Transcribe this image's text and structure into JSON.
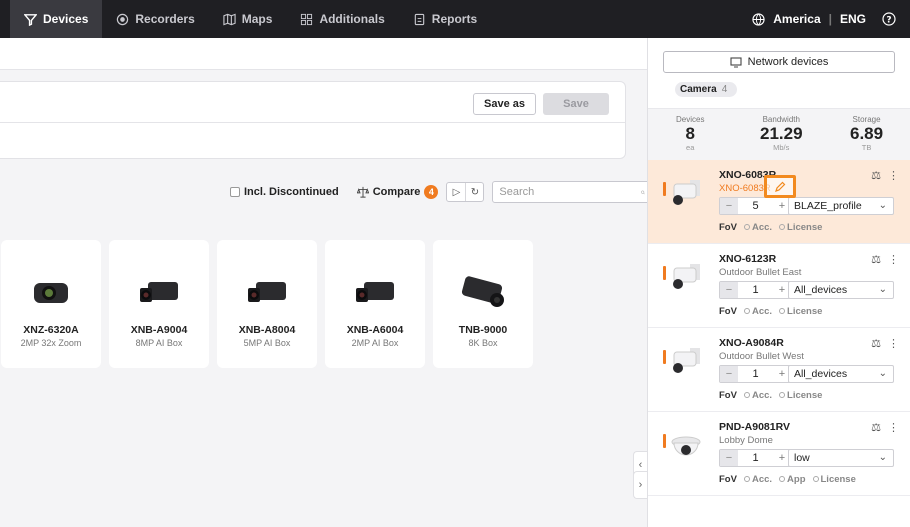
{
  "nav": {
    "tabs": [
      {
        "label": "Devices",
        "icon": "devices-icon"
      },
      {
        "label": "Recorders",
        "icon": "recorder-icon"
      },
      {
        "label": "Maps",
        "icon": "map-icon"
      },
      {
        "label": "Additionals",
        "icon": "grid-icon"
      },
      {
        "label": "Reports",
        "icon": "report-icon"
      }
    ],
    "region": "America",
    "language": "ENG"
  },
  "save": {
    "save_as_label": "Save as",
    "save_label": "Save"
  },
  "toolbar": {
    "discontinued_label": "Incl. Discontinued",
    "compare_label": "Compare",
    "compare_count": "4",
    "search_placeholder": "Search"
  },
  "products": [
    {
      "name": "XNZ-6320A",
      "desc": "2MP 32x Zoom"
    },
    {
      "name": "XNB-A9004",
      "desc": "8MP AI Box"
    },
    {
      "name": "XNB-A8004",
      "desc": "5MP AI Box"
    },
    {
      "name": "XNB-A6004",
      "desc": "2MP AI Box"
    },
    {
      "name": "TNB-9000",
      "desc": "8K Box"
    }
  ],
  "panel": {
    "network_button_label": "Network devices",
    "camera_tab": {
      "label": "Camera",
      "count": "4"
    },
    "stats": {
      "devices": {
        "label": "Devices",
        "value": "8",
        "unit": "ea"
      },
      "bandwidth": {
        "label": "Bandwidth",
        "value": "21.29",
        "unit": "Mb/s"
      },
      "storage": {
        "label": "Storage",
        "value": "6.89",
        "unit": "TB"
      }
    },
    "devices": [
      {
        "model": "XNO-6083R",
        "alias": "XNO-6083R",
        "qty": "5",
        "profile": "BLAZE_profile",
        "opts": [
          "FoV",
          "Acc.",
          "License"
        ]
      },
      {
        "model": "XNO-6123R",
        "alias": "Outdoor Bullet East",
        "qty": "1",
        "profile": "All_devices",
        "opts": [
          "FoV",
          "Acc.",
          "License"
        ]
      },
      {
        "model": "XNO-A9084R",
        "alias": "Outdoor Bullet West",
        "qty": "1",
        "profile": "All_devices",
        "opts": [
          "FoV",
          "Acc.",
          "License"
        ]
      },
      {
        "model": "PND-A9081RV",
        "alias": "Lobby Dome",
        "qty": "1",
        "profile": "low",
        "opts": [
          "FoV",
          "Acc.",
          "App",
          "License"
        ]
      }
    ]
  },
  "colors": {
    "accent": "#f07b20",
    "nav_bg": "#1f1f23",
    "selected_bg": "#fde9d9"
  }
}
